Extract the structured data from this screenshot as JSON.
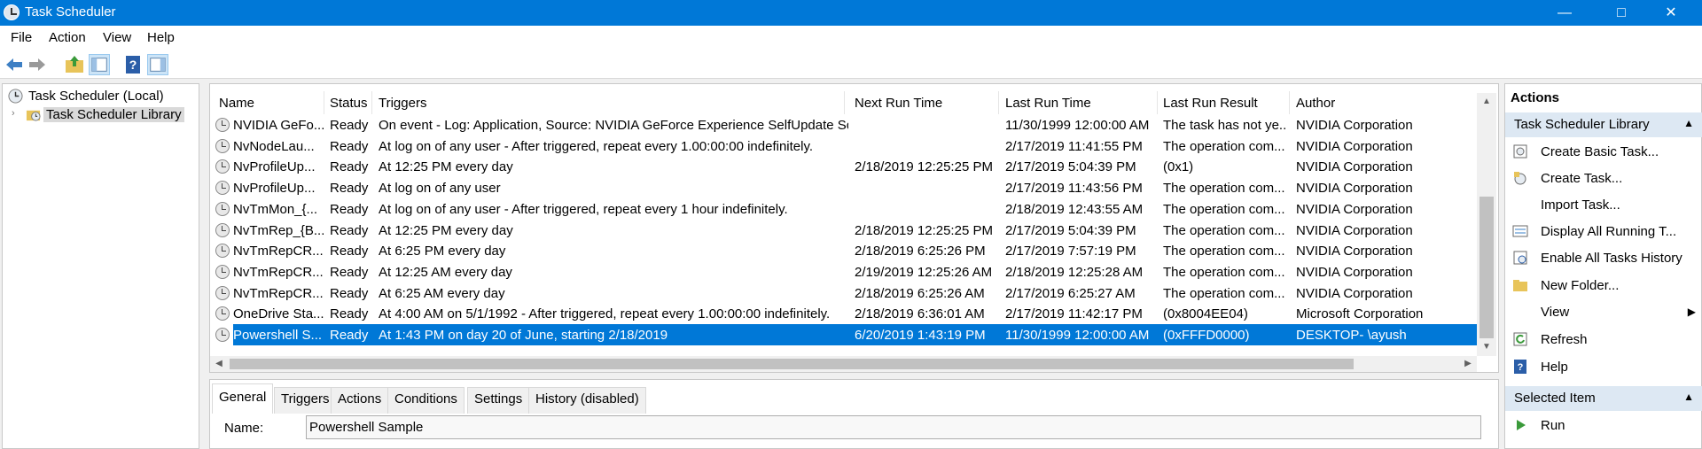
{
  "window": {
    "title": "Task Scheduler"
  },
  "menu": [
    "File",
    "Action",
    "View",
    "Help"
  ],
  "tree": {
    "root": "Task Scheduler (Local)",
    "library": "Task Scheduler Library"
  },
  "columns": [
    "Name",
    "Status",
    "Triggers",
    "Next Run Time",
    "Last Run Time",
    "Last Run Result",
    "Author"
  ],
  "rows": [
    {
      "name": "NVIDIA GeFo...",
      "status": "Ready",
      "triggers": "On event - Log: Application, Source: NVIDIA GeForce Experience SelfUpdate So...",
      "next_run": "",
      "last_run": "11/30/1999 12:00:00 AM",
      "result": "The task has not ye...",
      "author": "NVIDIA Corporation"
    },
    {
      "name": "NvNodeLau...",
      "status": "Ready",
      "triggers": "At log on of any user - After triggered, repeat every 1.00:00:00 indefinitely.",
      "next_run": "",
      "last_run": "2/17/2019 11:41:55 PM",
      "result": "The operation com...",
      "author": "NVIDIA Corporation"
    },
    {
      "name": "NvProfileUp...",
      "status": "Ready",
      "triggers": "At 12:25 PM every day",
      "next_run": "2/18/2019 12:25:25 PM",
      "last_run": "2/17/2019 5:04:39 PM",
      "result": "(0x1)",
      "author": "NVIDIA Corporation"
    },
    {
      "name": "NvProfileUp...",
      "status": "Ready",
      "triggers": "At log on of any user",
      "next_run": "",
      "last_run": "2/17/2019 11:43:56 PM",
      "result": "The operation com...",
      "author": "NVIDIA Corporation"
    },
    {
      "name": "NvTmMon_{...",
      "status": "Ready",
      "triggers": "At log on of any user - After triggered, repeat every 1 hour indefinitely.",
      "next_run": "",
      "last_run": "2/18/2019 12:43:55 AM",
      "result": "The operation com...",
      "author": "NVIDIA Corporation"
    },
    {
      "name": "NvTmRep_{B...",
      "status": "Ready",
      "triggers": "At 12:25 PM every day",
      "next_run": "2/18/2019 12:25:25 PM",
      "last_run": "2/17/2019 5:04:39 PM",
      "result": "The operation com...",
      "author": "NVIDIA Corporation"
    },
    {
      "name": "NvTmRepCR...",
      "status": "Ready",
      "triggers": "At 6:25 PM every day",
      "next_run": "2/18/2019 6:25:26 PM",
      "last_run": "2/17/2019 7:57:19 PM",
      "result": "The operation com...",
      "author": "NVIDIA Corporation"
    },
    {
      "name": "NvTmRepCR...",
      "status": "Ready",
      "triggers": "At 12:25 AM every day",
      "next_run": "2/19/2019 12:25:26 AM",
      "last_run": "2/18/2019 12:25:28 AM",
      "result": "The operation com...",
      "author": "NVIDIA Corporation"
    },
    {
      "name": "NvTmRepCR...",
      "status": "Ready",
      "triggers": "At 6:25 AM every day",
      "next_run": "2/18/2019 6:25:26 AM",
      "last_run": "2/17/2019 6:25:27 AM",
      "result": "The operation com...",
      "author": "NVIDIA Corporation"
    },
    {
      "name": "OneDrive Sta...",
      "status": "Ready",
      "triggers": "At 4:00 AM on 5/1/1992 - After triggered, repeat every 1.00:00:00 indefinitely.",
      "next_run": "2/18/2019 6:36:01 AM",
      "last_run": "2/17/2019 11:42:17 PM",
      "result": "(0x8004EE04)",
      "author": "Microsoft Corporation"
    },
    {
      "name": "Powershell S...",
      "status": "Ready",
      "triggers": "At 1:43 PM  on day 20 of June, starting 2/18/2019",
      "next_run": "6/20/2019 1:43:19 PM",
      "last_run": "11/30/1999 12:00:00 AM",
      "result": "(0xFFFD0000)",
      "author": "DESKTOP-       \\ayush"
    }
  ],
  "tabs": [
    "General",
    "Triggers",
    "Actions",
    "Conditions",
    "Settings",
    "History (disabled)"
  ],
  "general": {
    "name_label": "Name:",
    "name_value": "Powershell Sample"
  },
  "actions_pane": {
    "title": "Actions",
    "section1": "Task Scheduler Library",
    "items1": [
      "Create Basic Task...",
      "Create Task...",
      "Import Task...",
      "Display All Running T...",
      "Enable All Tasks History",
      "New Folder...",
      "View",
      "Refresh",
      "Help"
    ],
    "section2": "Selected Item",
    "items2": [
      "Run"
    ]
  },
  "colors": {
    "titlebar": "#0078d7",
    "selection": "#0078d7",
    "highlight": "#e8141e"
  }
}
